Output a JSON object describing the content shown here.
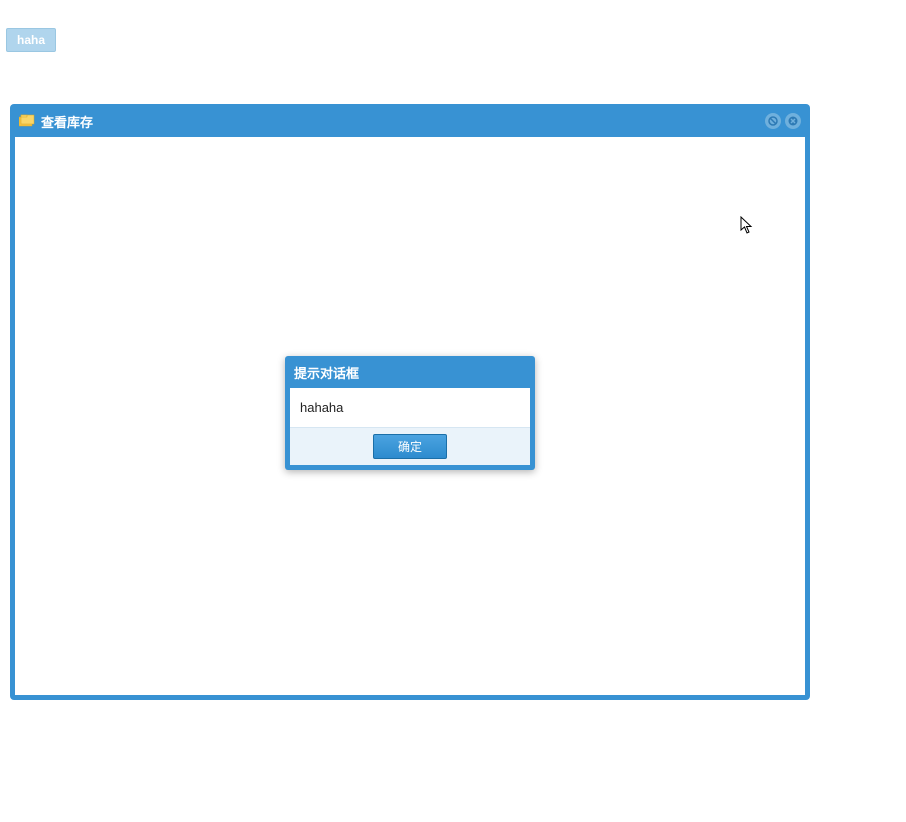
{
  "topButton": {
    "label": "haha"
  },
  "mainWindow": {
    "title": "查看库存",
    "iconName": "folder-stack-icon"
  },
  "dialog": {
    "title": "提示对话框",
    "message": "hahaha",
    "okLabel": "确定"
  }
}
